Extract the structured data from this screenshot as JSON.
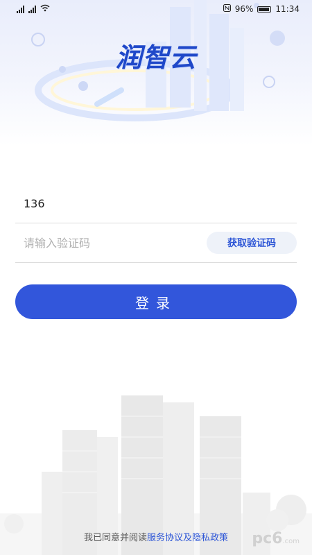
{
  "status_bar": {
    "left_signal_1": "4G",
    "left_signal_2": "4G",
    "battery": "96%",
    "time": "11:34"
  },
  "header": {
    "logo_text": "润智云"
  },
  "form": {
    "phone_value": "136",
    "code_placeholder": "请输入验证码",
    "get_code_label": "获取验证码",
    "login_label": "登录"
  },
  "footer": {
    "agreement_prefix": "我已同意并阅读",
    "agreement_link": "服务协议及隐私政策",
    "watermark": "pc6",
    "watermark_suffix": ".com"
  },
  "colors": {
    "brand": "#3256db",
    "link": "#2c55d6"
  }
}
